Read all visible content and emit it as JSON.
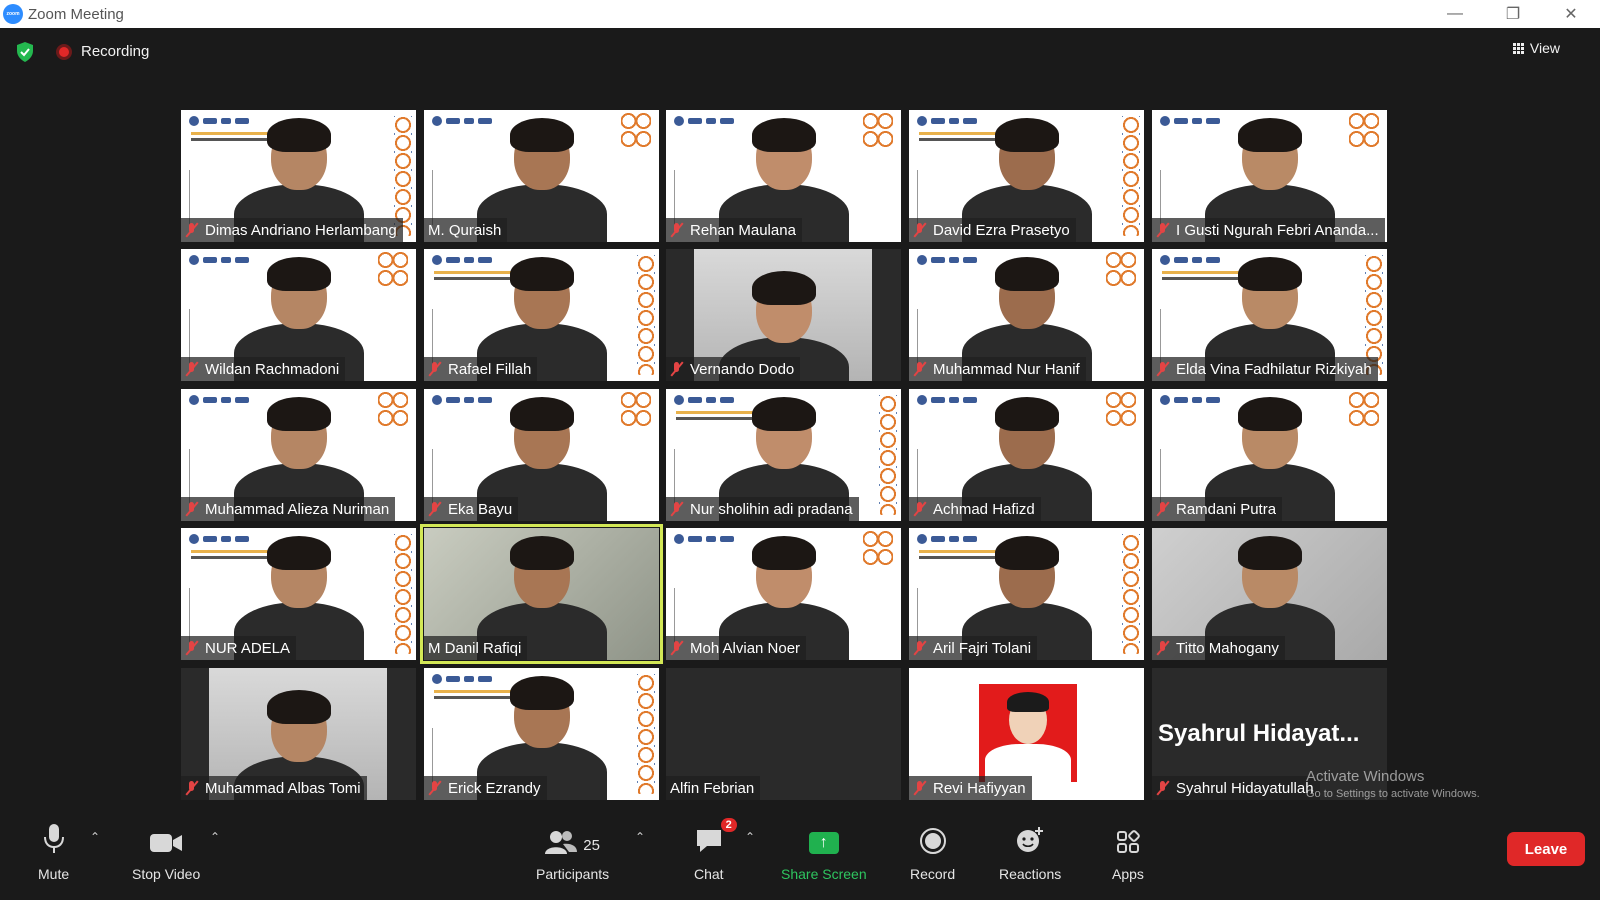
{
  "window": {
    "title": "Zoom Meeting",
    "app_logo_text": "zoom",
    "minimize": "—",
    "restore": "❐",
    "close": "✕"
  },
  "topbar": {
    "recording_label": "Recording",
    "view_label": "View"
  },
  "participants": [
    {
      "name": "Dimas Andriano Herlambang",
      "muted": true,
      "bg": "slide"
    },
    {
      "name": "M. Quraish",
      "muted": false,
      "bg": "slide"
    },
    {
      "name": "Rehan Maulana",
      "muted": true,
      "bg": "slide"
    },
    {
      "name": "David Ezra Prasetyo",
      "muted": true,
      "bg": "slide"
    },
    {
      "name": "I Gusti Ngurah Febri Ananda...",
      "muted": true,
      "bg": "slide"
    },
    {
      "name": "Wildan Rachmadoni",
      "muted": true,
      "bg": "slide"
    },
    {
      "name": "Rafael Fillah",
      "muted": true,
      "bg": "slide"
    },
    {
      "name": "Vernando Dodo",
      "muted": true,
      "bg": "wall"
    },
    {
      "name": "Muhammad Nur Hanif",
      "muted": true,
      "bg": "slide"
    },
    {
      "name": "Elda Vina Fadhilatur Rizkiyah",
      "muted": true,
      "bg": "slide"
    },
    {
      "name": "Muhammad Alieza Nuriman",
      "muted": true,
      "bg": "slide"
    },
    {
      "name": "Eka Bayu",
      "muted": true,
      "bg": "slide"
    },
    {
      "name": "Nur sholihin adi pradana",
      "muted": true,
      "bg": "slide"
    },
    {
      "name": "Achmad Hafizd",
      "muted": true,
      "bg": "slide"
    },
    {
      "name": "Ramdani Putra",
      "muted": true,
      "bg": "slide"
    },
    {
      "name": "NUR ADELA",
      "muted": true,
      "bg": "slide"
    },
    {
      "name": "M Danil Rafiqi",
      "muted": false,
      "bg": "room",
      "active_speaker": true
    },
    {
      "name": "Moh Alvian Noer",
      "muted": true,
      "bg": "slide"
    },
    {
      "name": "Aril Fajri Tolani",
      "muted": true,
      "bg": "slide"
    },
    {
      "name": "Titto Mahogany",
      "muted": true,
      "bg": "grey"
    },
    {
      "name": "Muhammad Albas Tomi",
      "muted": true,
      "bg": "wall"
    },
    {
      "name": "Erick Ezrandy",
      "muted": true,
      "bg": "slide"
    },
    {
      "name": "Alfin Febrian",
      "muted": false,
      "bg": "none"
    },
    {
      "name": "Revi Hafiyyan",
      "muted": true,
      "bg": "photo"
    },
    {
      "name": "Syahrul Hidayatullah",
      "muted": true,
      "bg": "namecard",
      "display_text": "Syahrul  Hidayat..."
    }
  ],
  "watermark": {
    "line1": "Activate Windows",
    "line2": "Go to Settings to activate Windows."
  },
  "toolbar": {
    "mute": "Mute",
    "stop_video": "Stop Video",
    "participants": "Participants",
    "participants_count": "25",
    "chat": "Chat",
    "chat_badge": "2",
    "share_screen": "Share Screen",
    "record": "Record",
    "reactions": "Reactions",
    "apps": "Apps",
    "leave": "Leave"
  },
  "colors": {
    "accent_green": "#2ec55f",
    "leave_red": "#e02828",
    "active_speaker": "#d3e856",
    "background": "#1a1a1a"
  }
}
